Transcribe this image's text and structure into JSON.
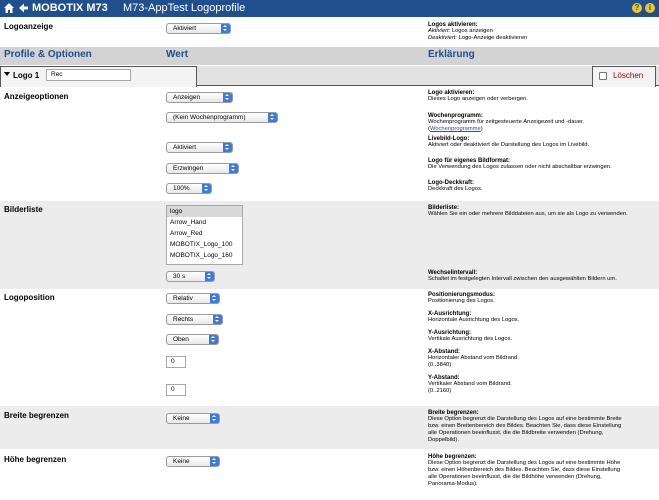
{
  "header": {
    "brand": "MOBOTIX M73",
    "title": "M73-AppTest Logoprofile",
    "help": "?",
    "info": "i"
  },
  "logoanzeige": {
    "label": "Logoanzeige",
    "value": "Aktiviert",
    "expl_title": "Logos aktivieren:",
    "expl_line1_em": "Aktiviert:",
    "expl_line1": "Logos anzeigen",
    "expl_line2_em": "Deaktiviert:",
    "expl_line2": "Logo-Anzeige deaktivieren"
  },
  "columns": {
    "c1": "Profile & Optionen",
    "c2": "Wert",
    "c3": "Erklärung"
  },
  "tab": {
    "label": "Logo 1",
    "name_value": "Rec",
    "delete_label": "Löschen"
  },
  "anzeige": {
    "label": "Anzeigeoptionen",
    "sel1": "Anzeigen",
    "sel2": "(Kein Wochenprogramm)",
    "sel3": "Aktiviert",
    "sel4": "Erzwingen",
    "sel5": "100%",
    "e1_t": "Logo aktivieren:",
    "e1_d": "Dieses Logo anzeigen oder verbergen.",
    "e2_t": "Wochenprogramm:",
    "e2_d": "Wochenprogramm für zeitgesteuerte Anzeigezeit und -dauer.",
    "e2_link": "Wochenprogramme",
    "e3_t": "Livebild-Logo:",
    "e3_d": "Aktiviert oder deaktiviert die Darstellung des Logos im Livebild.",
    "e4_t": "Logo für eigenes Bildformat:",
    "e4_d": "Die Verwendung des Logos zulassen oder nicht abschaltbar erzwingen.",
    "e5_t": "Logo-Deckkraft:",
    "e5_d": "Deckkraft des Logos."
  },
  "bilderliste": {
    "label": "Bilderliste",
    "items": [
      "logo",
      "Arrow_Hand",
      "Arrow_Red",
      "MOBOTIX_Logo_100",
      "MOBOTIX_Logo_160"
    ],
    "interval": "30 s",
    "e1_t": "Bilderliste:",
    "e1_d": "Wählen Sie ein oder mehrere Bilddateien aus, um sie als Logo zu verwenden.",
    "e2_t": "Wechselintervall:",
    "e2_d": "Schaltet im festgelegten Intervall zwischen den ausgewählten Bildern um."
  },
  "position": {
    "label": "Logoposition",
    "mode": "Relativ",
    "x_align": "Rechts",
    "y_align": "Oben",
    "x_dist": "0",
    "y_dist": "0",
    "e1_t": "Positionierungsmodus:",
    "e1_d": "Positionierung des Logos.",
    "e2_t": "X-Ausrichtung:",
    "e2_d": "Horizontale Ausrichtung des Logos.",
    "e3_t": "Y-Ausrichtung:",
    "e3_d": "Vertikale Ausrichtung des Logos.",
    "e4_t": "X-Abstand:",
    "e4_d": "Horizontaler Abstand vom Bildrand.",
    "e4_r": "(0..3840)",
    "e5_t": "Y-Abstand:",
    "e5_d": "Vertikaler Abstand vom Bildrand.",
    "e5_r": "(0..2160)"
  },
  "breite": {
    "label": "Breite begrenzen",
    "value": "Keine",
    "e_t": "Breite begrenzen:",
    "e_d1": "Diese Option begrenzt die Darstellung des Logos auf eine bestimmte Breite",
    "e_d2": "bzw. einen Breitenbereich des Bildes. Beachten Sie, dass diese Einstellung",
    "e_d3": "alle Operationen beeinflusst, die die Bildbreite verwenden (Drehung,",
    "e_d4": "Doppelbild)."
  },
  "hoehe": {
    "label": "Höhe begrenzen",
    "value": "Keine",
    "e_t": "Höhe begrenzen:",
    "e_d1": "Diese Option begrenzt die Darstellung des Logos auf eine bestimmte Höhe",
    "e_d2": "bzw. einen Höhenbereich des Bildes. Beachten Sie, dass diese Einstellung",
    "e_d3": "alle Operationen beeinflusst, die die Bildhöhe verwenden (Drehung,",
    "e_d4": "Panorama-Modus)."
  }
}
